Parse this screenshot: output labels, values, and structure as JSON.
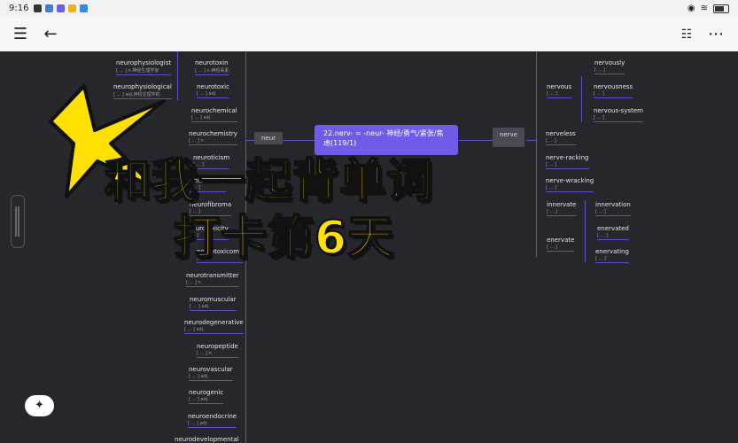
{
  "status_bar": {
    "time": "9:16"
  },
  "app_bar": {
    "menu_icon": "hamburger-menu-icon",
    "back_icon": "back-arrow-icon",
    "outline_icon": "outline-list-icon",
    "more_icon": "more-dots-icon"
  },
  "center_node": {
    "title": "22.nerv- = -neur- 神经/勇气/紧张/焦",
    "subtitle": "虑(119/1)"
  },
  "tags": {
    "neur": "neur",
    "nerve": "nerve"
  },
  "left_col_a": [
    {
      "word": "neurophysiologist",
      "meaning": "[ ... ] n.神经生理学家"
    },
    {
      "word": "neurophysiological",
      "meaning": "[ ... ] adj.神经生理学的"
    }
  ],
  "left_col_b": [
    {
      "word": "neurotoxin",
      "meaning": "[ ... ] n.神经毒素"
    },
    {
      "word": "neurotoxic",
      "meaning": "[ ... ] adj."
    },
    {
      "word": "neurochemical",
      "meaning": "[ ... ] adj."
    },
    {
      "word": "neurochemistry",
      "meaning": "[ ... ] n."
    },
    {
      "word": "neuroticism",
      "meaning": "[ ... ]"
    },
    {
      "word": "neurotically",
      "meaning": "[ ... ]"
    },
    {
      "word": "neurofibroma",
      "meaning": "[ ... ]"
    },
    {
      "word": "neurotoxicity",
      "meaning": "[ ... ]"
    },
    {
      "word": "neurotoxicome",
      "meaning": "[ ... ]"
    },
    {
      "word": "neurotransmitter",
      "meaning": "[ ... ] n."
    },
    {
      "word": "neuromuscular",
      "meaning": "[ ... ] adj."
    },
    {
      "word": "neurodegenerative",
      "meaning": "[ ... ] adj."
    },
    {
      "word": "neuropeptide",
      "meaning": "[ ... ] n."
    },
    {
      "word": "neurovascular",
      "meaning": "[ ... ] adj."
    },
    {
      "word": "neurogenic",
      "meaning": "[ ... ] adj."
    },
    {
      "word": "neuroendocrine",
      "meaning": "[ ... ] adj."
    },
    {
      "word": "neurodevelopmental",
      "meaning": "[ ... ]"
    }
  ],
  "right_col_a": [
    {
      "word": "nervous",
      "meaning": "[ ... ]"
    },
    {
      "word": "nerveless",
      "meaning": "[ ... ]"
    },
    {
      "word": "nerve-racking",
      "meaning": "[ ... ]"
    },
    {
      "word": "nerve-wracking",
      "meaning": "[ ... ]"
    },
    {
      "word": "innervate",
      "meaning": "[ ... ]"
    },
    {
      "word": "enervate",
      "meaning": "[ ... ]"
    }
  ],
  "right_col_b": [
    {
      "word": "nervously",
      "meaning": "[ ... ]"
    },
    {
      "word": "nervousness",
      "meaning": "[ ... ]"
    },
    {
      "word": "nervous-system",
      "meaning": "[ ... ]"
    },
    {
      "word": "innervation",
      "meaning": "[ ... ]"
    },
    {
      "word": "enervated",
      "meaning": "[ ... ]"
    },
    {
      "word": "enervating",
      "meaning": "[ ... ]"
    }
  ],
  "overlay": {
    "line1": "和我一起背单词",
    "line2": "打卡第6天"
  },
  "colors": {
    "accent": "#6c5ce7",
    "overlay_yellow": "#ffe000",
    "canvas": "#26272b"
  }
}
